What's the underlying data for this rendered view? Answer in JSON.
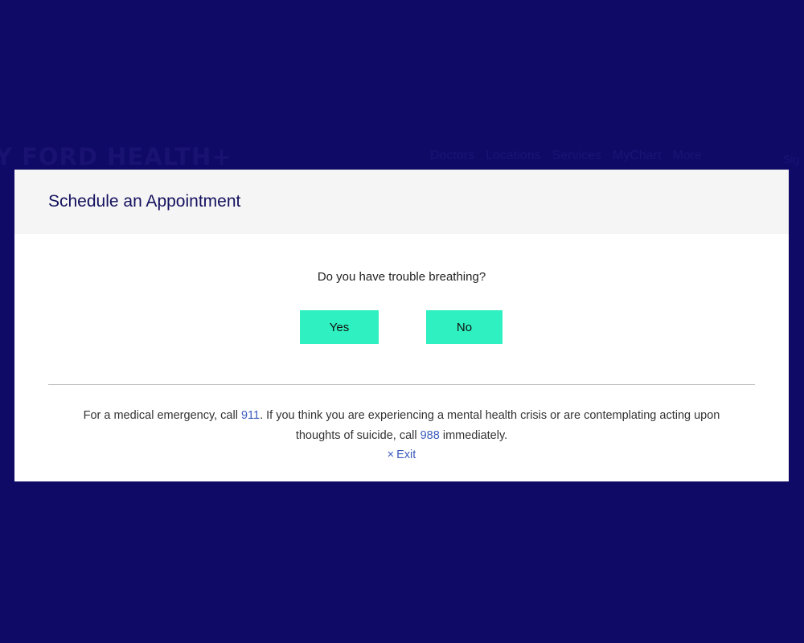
{
  "background": {
    "logo_text": "Y FORD HEALTH+",
    "nav_items": [
      "Doctors",
      "Locations",
      "Services",
      "MyChart",
      "More"
    ],
    "signin_text": "Sig"
  },
  "dialog": {
    "title": "Schedule an Appointment",
    "question": "Do you have trouble breathing?",
    "yes_label": "Yes",
    "no_label": "No",
    "emergency": {
      "part1": "For a medical emergency, call ",
      "emergency_number": "911",
      "part2": ". If you think you are experiencing a mental health crisis or are contemplating acting upon thoughts of suicide, call ",
      "crisis_number": "988",
      "part3": " immediately."
    },
    "exit_icon": "×",
    "exit_label": "Exit"
  },
  "colors": {
    "backdrop": "#0f0a66",
    "accent_button": "#2ff0c0",
    "link": "#3b5bbd",
    "title": "#14115e"
  }
}
